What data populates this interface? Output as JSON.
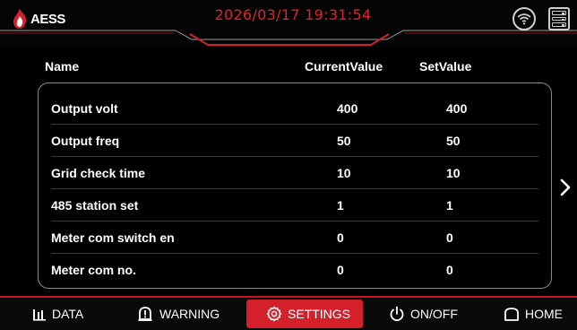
{
  "header": {
    "logo_text": "AESS",
    "datetime": "2026/03/17  19:31:54"
  },
  "columns": {
    "name": "Name",
    "current": "CurrentValue",
    "set": "SetValue"
  },
  "rows": [
    {
      "name": "Output volt",
      "current": "400",
      "set": "400"
    },
    {
      "name": "Output freq",
      "current": "50",
      "set": "50"
    },
    {
      "name": "Grid check time",
      "current": "10",
      "set": "10"
    },
    {
      "name": "485 station set",
      "current": "1",
      "set": "1"
    },
    {
      "name": "Meter com switch en",
      "current": "0",
      "set": "0"
    },
    {
      "name": "Meter com no.",
      "current": "0",
      "set": "0"
    }
  ],
  "nav": {
    "data": "DATA",
    "warning": "WARNING",
    "settings": "SETTINGS",
    "onoff": "ON/OFF",
    "home": "HOME"
  },
  "colors": {
    "accent": "#d4202a",
    "clock": "#e0232b",
    "background": "#000000"
  }
}
